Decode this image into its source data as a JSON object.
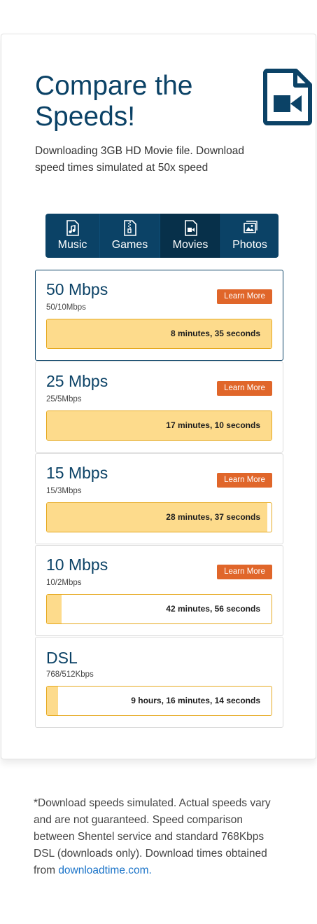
{
  "header": {
    "title": "Compare the Speeds!",
    "subtitle": "Downloading 3GB HD Movie file. Download speed times simulated at 50x speed",
    "hero_icon": "movie-file-icon",
    "accent_color": "#0b4266"
  },
  "tabs": [
    {
      "label": "Music",
      "icon": "music-file-icon",
      "active": false
    },
    {
      "label": "Games",
      "icon": "zip-file-icon",
      "active": false
    },
    {
      "label": "Movies",
      "icon": "video-file-icon",
      "active": true
    },
    {
      "label": "Photos",
      "icon": "image-icon",
      "active": false
    }
  ],
  "speeds": [
    {
      "name": "50 Mbps",
      "sub": "50/10Mbps",
      "button": "Learn More",
      "time": "8 minutes, 35 seconds",
      "progress": 1.0,
      "active": true
    },
    {
      "name": "25 Mbps",
      "sub": "25/5Mbps",
      "button": "Learn More",
      "time": "17 minutes, 10 seconds",
      "progress": 1.0
    },
    {
      "name": "15 Mbps",
      "sub": "15/3Mbps",
      "button": "Learn More",
      "time": "28 minutes, 37 seconds",
      "progress": 0.98
    },
    {
      "name": "10 Mbps",
      "sub": "10/2Mbps",
      "button": "Learn More",
      "time": "42 minutes, 56 seconds",
      "progress": 0.065
    },
    {
      "name": "DSL",
      "sub": "768/512Kbps",
      "button": "",
      "time": "9 hours, 16 minutes, 14 seconds",
      "progress": 0.05
    }
  ],
  "footnote": {
    "text": "*Download speeds simulated. Actual speeds vary and are not guaranteed. Speed comparison between Shentel service and standard 768Kbps DSL (downloads only). Download times obtained from ",
    "link": "downloadtime.com."
  },
  "colors": {
    "button": "#e0662a",
    "bar_fill": "#fddb8c",
    "bar_border": "#e6a91f"
  }
}
